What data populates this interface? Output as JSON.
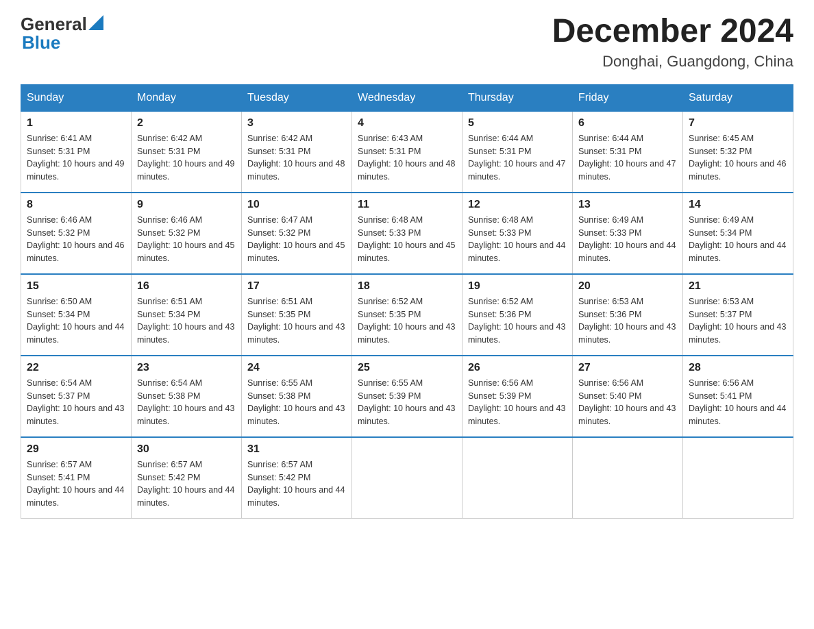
{
  "header": {
    "logo_general": "General",
    "logo_blue": "Blue",
    "month_title": "December 2024",
    "location": "Donghai, Guangdong, China"
  },
  "days_of_week": [
    "Sunday",
    "Monday",
    "Tuesday",
    "Wednesday",
    "Thursday",
    "Friday",
    "Saturday"
  ],
  "weeks": [
    {
      "days": [
        {
          "number": "1",
          "sunrise": "6:41 AM",
          "sunset": "5:31 PM",
          "daylight": "10 hours and 49 minutes."
        },
        {
          "number": "2",
          "sunrise": "6:42 AM",
          "sunset": "5:31 PM",
          "daylight": "10 hours and 49 minutes."
        },
        {
          "number": "3",
          "sunrise": "6:42 AM",
          "sunset": "5:31 PM",
          "daylight": "10 hours and 48 minutes."
        },
        {
          "number": "4",
          "sunrise": "6:43 AM",
          "sunset": "5:31 PM",
          "daylight": "10 hours and 48 minutes."
        },
        {
          "number": "5",
          "sunrise": "6:44 AM",
          "sunset": "5:31 PM",
          "daylight": "10 hours and 47 minutes."
        },
        {
          "number": "6",
          "sunrise": "6:44 AM",
          "sunset": "5:31 PM",
          "daylight": "10 hours and 47 minutes."
        },
        {
          "number": "7",
          "sunrise": "6:45 AM",
          "sunset": "5:32 PM",
          "daylight": "10 hours and 46 minutes."
        }
      ]
    },
    {
      "days": [
        {
          "number": "8",
          "sunrise": "6:46 AM",
          "sunset": "5:32 PM",
          "daylight": "10 hours and 46 minutes."
        },
        {
          "number": "9",
          "sunrise": "6:46 AM",
          "sunset": "5:32 PM",
          "daylight": "10 hours and 45 minutes."
        },
        {
          "number": "10",
          "sunrise": "6:47 AM",
          "sunset": "5:32 PM",
          "daylight": "10 hours and 45 minutes."
        },
        {
          "number": "11",
          "sunrise": "6:48 AM",
          "sunset": "5:33 PM",
          "daylight": "10 hours and 45 minutes."
        },
        {
          "number": "12",
          "sunrise": "6:48 AM",
          "sunset": "5:33 PM",
          "daylight": "10 hours and 44 minutes."
        },
        {
          "number": "13",
          "sunrise": "6:49 AM",
          "sunset": "5:33 PM",
          "daylight": "10 hours and 44 minutes."
        },
        {
          "number": "14",
          "sunrise": "6:49 AM",
          "sunset": "5:34 PM",
          "daylight": "10 hours and 44 minutes."
        }
      ]
    },
    {
      "days": [
        {
          "number": "15",
          "sunrise": "6:50 AM",
          "sunset": "5:34 PM",
          "daylight": "10 hours and 44 minutes."
        },
        {
          "number": "16",
          "sunrise": "6:51 AM",
          "sunset": "5:34 PM",
          "daylight": "10 hours and 43 minutes."
        },
        {
          "number": "17",
          "sunrise": "6:51 AM",
          "sunset": "5:35 PM",
          "daylight": "10 hours and 43 minutes."
        },
        {
          "number": "18",
          "sunrise": "6:52 AM",
          "sunset": "5:35 PM",
          "daylight": "10 hours and 43 minutes."
        },
        {
          "number": "19",
          "sunrise": "6:52 AM",
          "sunset": "5:36 PM",
          "daylight": "10 hours and 43 minutes."
        },
        {
          "number": "20",
          "sunrise": "6:53 AM",
          "sunset": "5:36 PM",
          "daylight": "10 hours and 43 minutes."
        },
        {
          "number": "21",
          "sunrise": "6:53 AM",
          "sunset": "5:37 PM",
          "daylight": "10 hours and 43 minutes."
        }
      ]
    },
    {
      "days": [
        {
          "number": "22",
          "sunrise": "6:54 AM",
          "sunset": "5:37 PM",
          "daylight": "10 hours and 43 minutes."
        },
        {
          "number": "23",
          "sunrise": "6:54 AM",
          "sunset": "5:38 PM",
          "daylight": "10 hours and 43 minutes."
        },
        {
          "number": "24",
          "sunrise": "6:55 AM",
          "sunset": "5:38 PM",
          "daylight": "10 hours and 43 minutes."
        },
        {
          "number": "25",
          "sunrise": "6:55 AM",
          "sunset": "5:39 PM",
          "daylight": "10 hours and 43 minutes."
        },
        {
          "number": "26",
          "sunrise": "6:56 AM",
          "sunset": "5:39 PM",
          "daylight": "10 hours and 43 minutes."
        },
        {
          "number": "27",
          "sunrise": "6:56 AM",
          "sunset": "5:40 PM",
          "daylight": "10 hours and 43 minutes."
        },
        {
          "number": "28",
          "sunrise": "6:56 AM",
          "sunset": "5:41 PM",
          "daylight": "10 hours and 44 minutes."
        }
      ]
    },
    {
      "days": [
        {
          "number": "29",
          "sunrise": "6:57 AM",
          "sunset": "5:41 PM",
          "daylight": "10 hours and 44 minutes."
        },
        {
          "number": "30",
          "sunrise": "6:57 AM",
          "sunset": "5:42 PM",
          "daylight": "10 hours and 44 minutes."
        },
        {
          "number": "31",
          "sunrise": "6:57 AM",
          "sunset": "5:42 PM",
          "daylight": "10 hours and 44 minutes."
        },
        null,
        null,
        null,
        null
      ]
    }
  ],
  "labels": {
    "sunrise": "Sunrise:",
    "sunset": "Sunset:",
    "daylight": "Daylight:"
  }
}
